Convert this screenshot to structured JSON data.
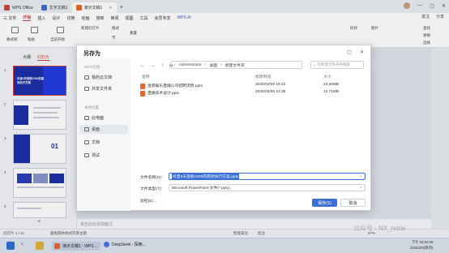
{
  "titlebar": {
    "tabs": [
      {
        "label": "WPS Office",
        "color": "#d1453b"
      },
      {
        "label": "文字文稿1",
        "color": "#3b6fd6"
      },
      {
        "label": "演示文稿1",
        "color": "#e8652b"
      }
    ]
  },
  "menubar": {
    "file": "三 文件",
    "items": [
      "开始",
      "插入",
      "设计",
      "切换",
      "动画",
      "放映",
      "审阅",
      "视图",
      "工具",
      "会员专享"
    ],
    "active": "开始",
    "ai": "WPS AI",
    "right": [
      "批注",
      "分享"
    ]
  },
  "ribbon": {
    "labels": [
      "格式刷",
      "粘贴",
      "当前开始",
      "新建幻灯片",
      "版式",
      "节",
      "重置",
      "形状",
      "图片",
      "查找",
      "替换",
      "选择"
    ]
  },
  "thumbpanel": {
    "tabs": [
      "大纲",
      "幻灯片"
    ],
    "active": "幻灯片",
    "slides": [
      {
        "num": "1",
        "text": "抖音3天涨粉1000的高效执行方案"
      },
      {
        "num": "2",
        "text": ""
      },
      {
        "num": "3",
        "text": "01"
      },
      {
        "num": "4",
        "text": ""
      },
      {
        "num": "5",
        "text": ""
      }
    ]
  },
  "notes": {
    "placeholder": "单击此处添加备注"
  },
  "statusbar": {
    "slide": "幻灯片 1 / 21",
    "font": "面板圆体样式风景主题",
    "smart": "智能美化",
    "comment": "批注",
    "zoom": "57%"
  },
  "taskbar": {
    "apps": [
      "演示文稿1 - WPS ...",
      "DeepSeek - 探索..."
    ],
    "time": "下午 02:53:25",
    "date": "2025/2/6(周四)"
  },
  "dialog": {
    "title": "另存为",
    "sidebar_top": "WPS云盘",
    "sidebar_items": [
      "我的云文档",
      "共享文件夹"
    ],
    "sidebar_group": "本地位置",
    "local_items": [
      "此电脑",
      "桌面",
      "文档",
      "测试"
    ],
    "selected_local": "桌面",
    "path": [
      "Administrator",
      "桌面",
      "新建文件夹"
    ],
    "search_placeholder": "在新建文件夹中搜索",
    "columns": {
      "name": "名称",
      "date": "修改时间",
      "size": "大小"
    },
    "files": [
      {
        "name": "金牌娱乐直播公司招聘流程.pptx",
        "date": "2025/02/05 16:22",
        "size": "23.26MB"
      },
      {
        "name": "直播技术设计.pptx",
        "date": "2025/02/05 14:35",
        "size": "12.71MB"
      }
    ],
    "filename_label": "文件名称(N)：",
    "filename_value": "抖音3天涨粉1000的高效执行方案.pptx",
    "filetype_label": "文件类型(T)：",
    "filetype_value": "Microsoft PowerPoint 文件(*.pptx)",
    "encrypt_label": "加密(E)...",
    "save": "保存(S)",
    "cancel": "取消"
  },
  "watermark": "公众号 · NX_none"
}
